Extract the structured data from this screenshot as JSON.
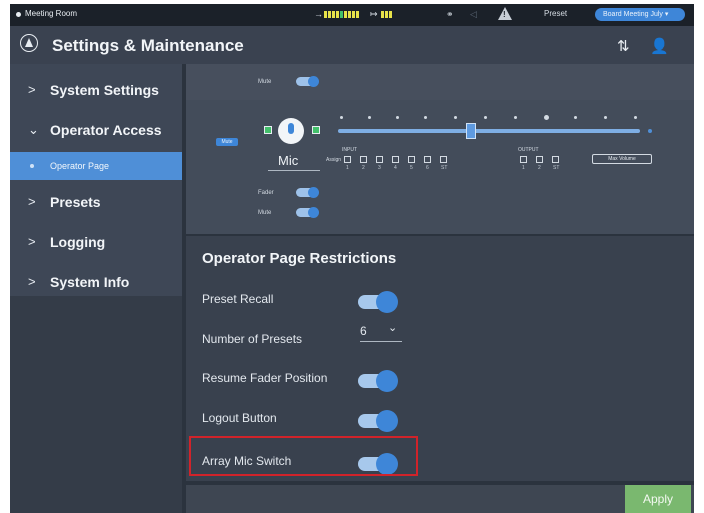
{
  "statusbar": {
    "room": "Meeting Room",
    "preset_label": "Preset",
    "preset_value": "Board Meeting July ▾"
  },
  "header": {
    "title": "Settings & Maintenance"
  },
  "sidebar": {
    "items": [
      {
        "label": "System Settings",
        "chevron": ">"
      },
      {
        "label": "Operator Access",
        "chevron": "⌄"
      },
      {
        "label": "Presets",
        "chevron": ">"
      },
      {
        "label": "Logging",
        "chevron": ">"
      },
      {
        "label": "System Info",
        "chevron": ">"
      }
    ],
    "subitem": "Operator Page"
  },
  "preview": {
    "mute_label": "Mute",
    "fader_label": "Fader",
    "mic_name": "Mic",
    "assign_label": "Assign",
    "input_label": "INPUT",
    "output_label": "OUTPUT",
    "input_numbers": [
      "1",
      "2",
      "3",
      "4",
      "5",
      "6",
      "ST"
    ],
    "output_numbers": [
      "1",
      "2",
      "ST"
    ],
    "max_volume_label": "Max Volume",
    "small_button_label": "Mute"
  },
  "restrictions": {
    "title": "Operator Page Restrictions",
    "preset_recall": "Preset Recall",
    "number_of_presets": "Number of Presets",
    "number_of_presets_value": "6",
    "resume_fader": "Resume Fader Position",
    "logout_button": "Logout Button",
    "array_mic_switch": "Array Mic Switch"
  },
  "footer": {
    "apply_label": "Apply"
  },
  "colors": {
    "accent": "#3e86d8",
    "highlight_border": "#d1232a",
    "apply": "#7ab86f"
  }
}
